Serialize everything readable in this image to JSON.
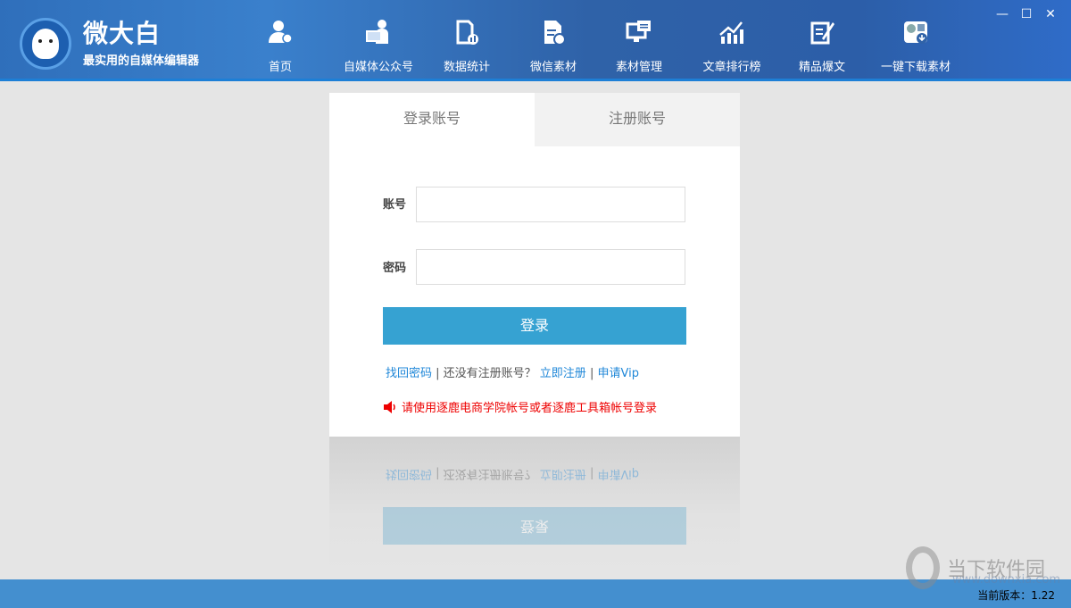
{
  "app": {
    "title": "微大白",
    "subtitle": "最实用的自媒体编辑器"
  },
  "nav": [
    {
      "label": "首页",
      "icon": "user-home-icon"
    },
    {
      "label": "自媒体公众号",
      "icon": "presenter-icon"
    },
    {
      "label": "数据统计",
      "icon": "document-chart-icon"
    },
    {
      "label": "微信素材",
      "icon": "document-link-icon"
    },
    {
      "label": "素材管理",
      "icon": "monitor-edit-icon"
    },
    {
      "label": "文章排行榜",
      "icon": "trend-chart-icon"
    },
    {
      "label": "精品爆文",
      "icon": "notepad-pen-icon"
    },
    {
      "label": "一键下载素材",
      "icon": "download-media-icon"
    }
  ],
  "window": {
    "minimize": "—",
    "maximize": "☐",
    "close": "✕"
  },
  "login": {
    "tabs": [
      "登录账号",
      "注册账号"
    ],
    "account_label": "账号",
    "account_value": "",
    "password_label": "密码",
    "password_value": "",
    "submit": "登录",
    "links": {
      "forgot": "找回密码",
      "sep1": " | 还没有注册账号？ ",
      "register": "立即注册",
      "sep2": " | ",
      "vip": "申请Vip"
    },
    "notice": "请使用逐鹿电商学院帐号或者逐鹿工具箱帐号登录"
  },
  "footer": {
    "version": "当前版本：1.22"
  },
  "watermark": {
    "name": "当下软件园",
    "url": "www.downxia.com"
  },
  "colors": {
    "header": "#2f6cb8",
    "button": "#36a2d2",
    "link": "#1f87d8",
    "notice": "#ee0000",
    "footer": "#448fcf"
  }
}
